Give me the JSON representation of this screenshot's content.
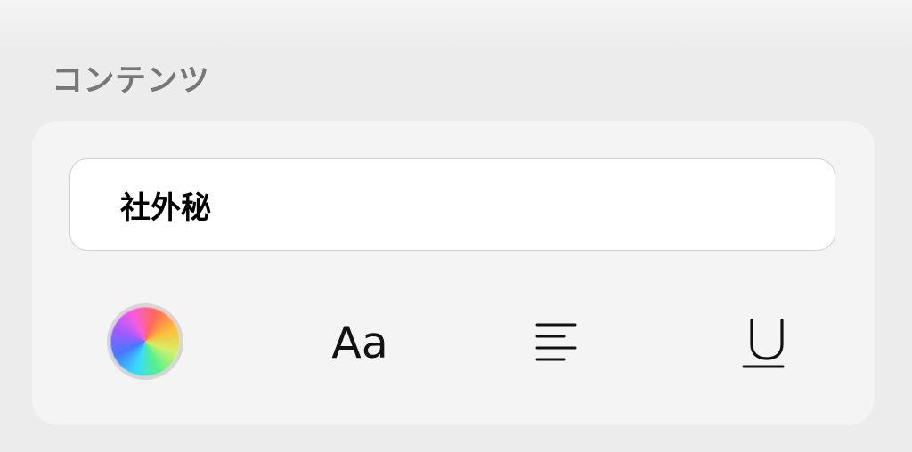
{
  "section": {
    "title": "コンテンツ"
  },
  "input": {
    "value": "社外秘"
  },
  "toolbar": {
    "items": [
      {
        "name": "color-picker",
        "icon": "color-wheel-icon"
      },
      {
        "name": "font-style",
        "icon": "font-icon",
        "label": "Aa"
      },
      {
        "name": "text-alignment",
        "icon": "align-left-icon"
      },
      {
        "name": "underline",
        "icon": "underline-icon"
      }
    ]
  },
  "colors": {
    "page_background": "#ececec",
    "card_background": "#f4f4f4",
    "input_background": "#ffffff",
    "title_text": "#777777",
    "icon_color": "#111111"
  }
}
